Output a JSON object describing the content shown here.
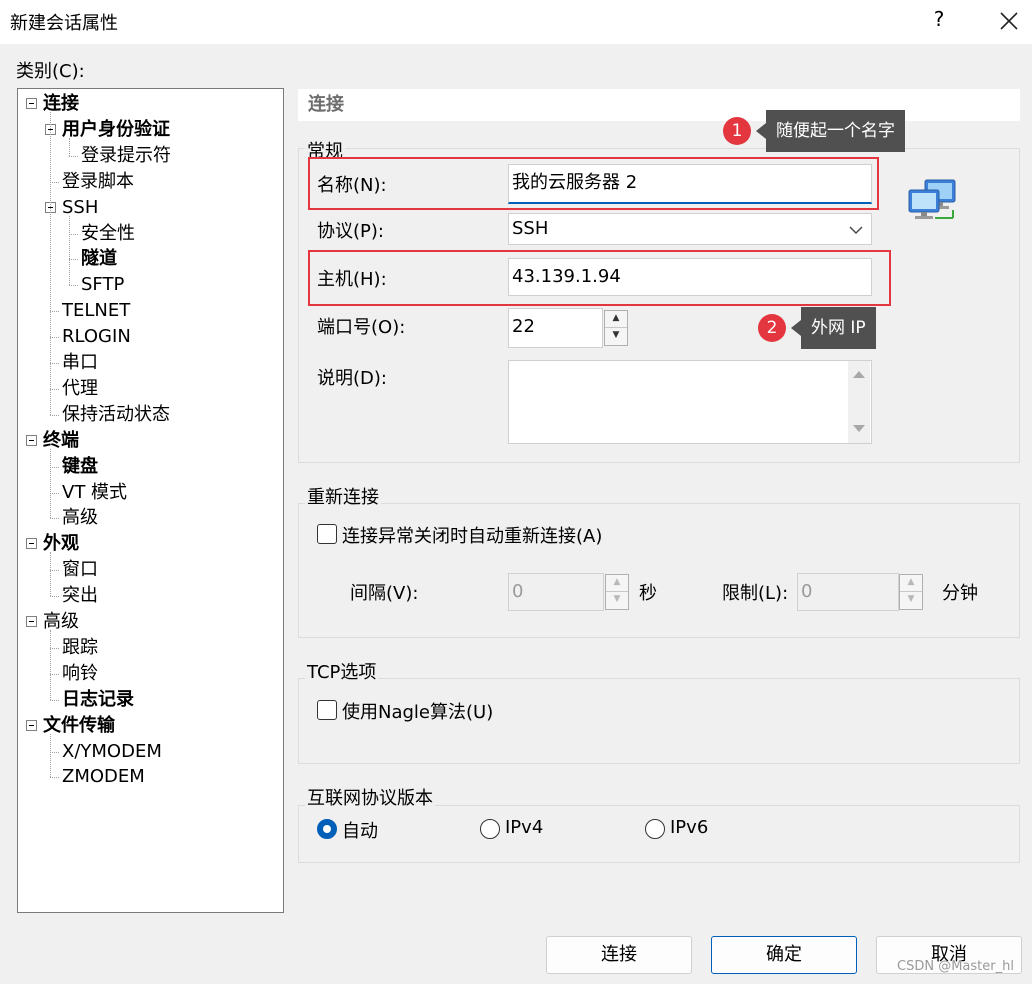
{
  "window": {
    "title": "新建会话属性",
    "help": "?"
  },
  "category_label": "类别(C):",
  "tree": [
    {
      "label": "连接",
      "bold": true,
      "level": 0,
      "expander": true
    },
    {
      "label": "用户身份验证",
      "bold": true,
      "level": 1,
      "expander": true
    },
    {
      "label": "登录提示符",
      "bold": false,
      "level": 2
    },
    {
      "label": "登录脚本",
      "bold": false,
      "level": 1
    },
    {
      "label": "SSH",
      "bold": false,
      "level": 1,
      "expander": true
    },
    {
      "label": "安全性",
      "bold": false,
      "level": 2
    },
    {
      "label": "隧道",
      "bold": true,
      "level": 2
    },
    {
      "label": "SFTP",
      "bold": false,
      "level": 2
    },
    {
      "label": "TELNET",
      "bold": false,
      "level": 1
    },
    {
      "label": "RLOGIN",
      "bold": false,
      "level": 1
    },
    {
      "label": "串口",
      "bold": false,
      "level": 1
    },
    {
      "label": "代理",
      "bold": false,
      "level": 1
    },
    {
      "label": "保持活动状态",
      "bold": false,
      "level": 1
    },
    {
      "label": "终端",
      "bold": true,
      "level": 0,
      "expander": true
    },
    {
      "label": "键盘",
      "bold": true,
      "level": 1
    },
    {
      "label": "VT 模式",
      "bold": false,
      "level": 1
    },
    {
      "label": "高级",
      "bold": false,
      "level": 1
    },
    {
      "label": "外观",
      "bold": true,
      "level": 0,
      "expander": true
    },
    {
      "label": "窗口",
      "bold": false,
      "level": 1
    },
    {
      "label": "突出",
      "bold": false,
      "level": 1
    },
    {
      "label": "高级",
      "bold": false,
      "level": 0,
      "expander": true
    },
    {
      "label": "跟踪",
      "bold": false,
      "level": 1
    },
    {
      "label": "响铃",
      "bold": false,
      "level": 1
    },
    {
      "label": "日志记录",
      "bold": true,
      "level": 1
    },
    {
      "label": "文件传输",
      "bold": true,
      "level": 0,
      "expander": true
    },
    {
      "label": "X/YMODEM",
      "bold": false,
      "level": 1
    },
    {
      "label": "ZMODEM",
      "bold": false,
      "level": 1
    }
  ],
  "section_header": "连接",
  "general": {
    "title": "常规",
    "name_label": "名称(N):",
    "name_value": "我的云服务器 2",
    "protocol_label": "协议(P):",
    "protocol_value": "SSH",
    "host_label": "主机(H):",
    "host_value": "43.139.1.94",
    "port_label": "端口号(O):",
    "port_value": "22",
    "desc_label": "说明(D):",
    "desc_value": ""
  },
  "reconnect": {
    "title": "重新连接",
    "checkbox_label": "连接异常关闭时自动重新连接(A)",
    "checked": false,
    "interval_label": "间隔(V):",
    "interval_value": "0",
    "interval_unit": "秒",
    "limit_label": "限制(L):",
    "limit_value": "0",
    "limit_unit": "分钟"
  },
  "tcp": {
    "title": "TCP选项",
    "nagle_label": "使用Nagle算法(U)",
    "checked": false
  },
  "ip_version": {
    "title": "互联网协议版本",
    "options": [
      "自动",
      "IPv4",
      "IPv6"
    ],
    "selected": "自动"
  },
  "annotations": [
    {
      "number": "1",
      "text": "随便起一个名字"
    },
    {
      "number": "2",
      "text": "外网 IP"
    }
  ],
  "buttons": {
    "connect": "连接",
    "ok": "确定",
    "cancel": "取消"
  },
  "watermark": "CSDN @Master_hl",
  "icons": {
    "network": "network-computers-icon",
    "close": "close-icon"
  },
  "colors": {
    "accent": "#005fb8",
    "annotation_red": "#e3363f",
    "tooltip_bg": "#505050"
  }
}
